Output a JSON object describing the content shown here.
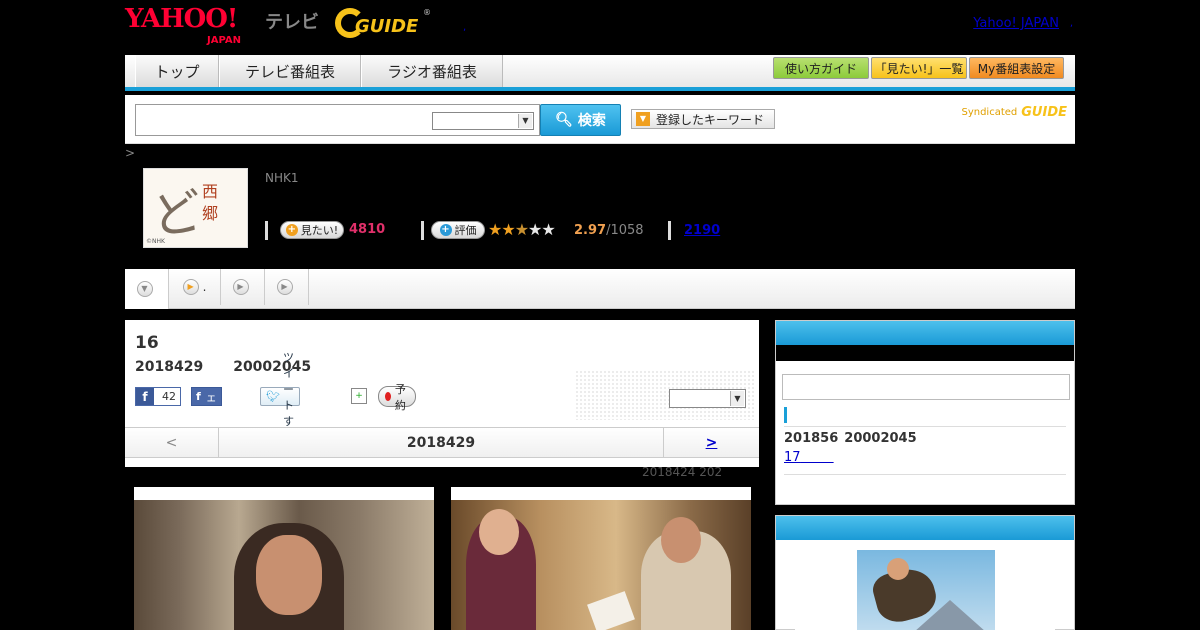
{
  "header": {
    "yahoo_logo": "YAHOO!",
    "yahoo_japan_sub": "JAPAN",
    "tv_label": "テレビ",
    "gguide_logo": "GUIDE",
    "yahoo_japan_link": "Yahoo! JAPAN",
    "sep_dot_1": ",",
    "sep_dot_2": ","
  },
  "nav": {
    "tabs": [
      {
        "label": "トップ"
      },
      {
        "label": "テレビ番組表"
      },
      {
        "label": "ラジオ番組表"
      }
    ],
    "buttons": [
      {
        "label": "使い方ガイド",
        "color": "#8ccb3a"
      },
      {
        "label": "「見たい!」一覧",
        "color": "#f7c21a"
      },
      {
        "label": "My番組表設定",
        "color": "#f08a20"
      }
    ]
  },
  "search": {
    "input_value": "",
    "select_value": "",
    "button_label": "検索",
    "keyword_button_label": "登録したキーワード",
    "syndicated_label": "Syndicated",
    "syndicated_logo": "GUIDE"
  },
  "breadcrumb": {
    "link": " ",
    "separator": ">"
  },
  "program": {
    "image_brush": "どん",
    "image_title": "西郷",
    "image_credit": "©NHK",
    "channel": "NHK1",
    "want_button_label": "見たい!",
    "want_count": "4810",
    "rate_button_label": "評価",
    "rating_value": "2.97",
    "rating_count": "/1058",
    "stars": {
      "full": 2,
      "half": 1,
      "empty": 2
    },
    "review_count": "2190"
  },
  "subtabs": [
    {
      "label": ""
    },
    {
      "label": "."
    },
    {
      "label": ""
    },
    {
      "label": ""
    }
  ],
  "episode": {
    "title": "16",
    "date": "2018429",
    "time": "20002045",
    "fb_like_count": "42",
    "share_label": "シェア",
    "tweet_label": "ツイートする",
    "reserve_label": "予約",
    "select_value": "",
    "pager_prev": "<",
    "pager_current": "2018429",
    "pager_next": ">",
    "update_text": "2018424  202"
  },
  "sidebar": {
    "next_date": "201856",
    "next_time": "20002045",
    "next_link": "17"
  },
  "colors": {
    "accent_blue": "#1aa0d8",
    "yahoo_red": "#ff0033",
    "gguide_yellow": "#f7c21a",
    "want_red": "#e0306a",
    "rating_orange": "#f0a050"
  }
}
